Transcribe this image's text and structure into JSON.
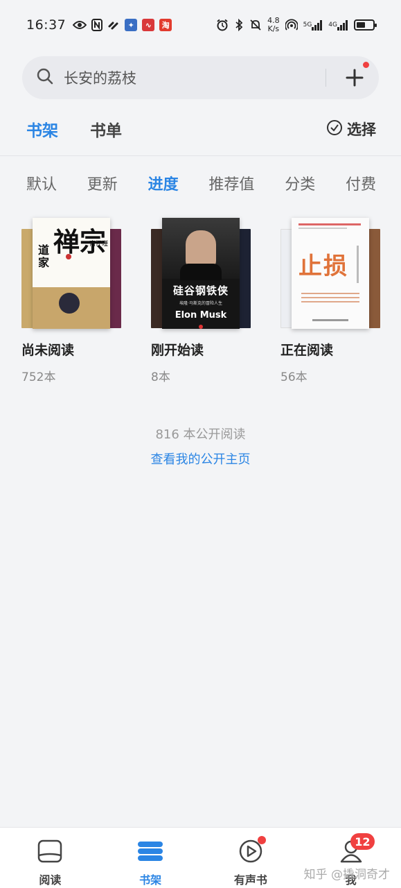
{
  "status_bar": {
    "time": "16:37",
    "net_speed_value": "4.8",
    "net_speed_unit": "K/s",
    "sim1_type": "5G",
    "sim2_type": "4G",
    "app_badges": [
      {
        "name": "flash-app-icon",
        "text": "∿",
        "color": "#d9383a"
      },
      {
        "name": "taobao-app-icon",
        "text": "淘",
        "color": "#e23b2e"
      }
    ]
  },
  "search": {
    "placeholder": "长安的荔枝"
  },
  "top_tabs": [
    {
      "label": "书架",
      "active": true
    },
    {
      "label": "书单",
      "active": false
    }
  ],
  "select_label": "选择",
  "sort_tabs": [
    {
      "label": "默认",
      "active": false
    },
    {
      "label": "更新",
      "active": false
    },
    {
      "label": "进度",
      "active": true
    },
    {
      "label": "推荐值",
      "active": false
    },
    {
      "label": "分类",
      "active": false
    },
    {
      "label": "付费",
      "active": false
    }
  ],
  "shelves": [
    {
      "name": "尚未阅读",
      "count": "752本",
      "cover_title": "禅宗",
      "cover_subtitle": "道家",
      "cover_author": "南怀瑾"
    },
    {
      "name": "刚开始读",
      "count": "8本",
      "cover_title": "硅谷钢铁侠",
      "cover_subtitle": "埃隆·马斯克的冒险人生",
      "cover_author": "Elon Musk"
    },
    {
      "name": "正在阅读",
      "count": "56本",
      "cover_title": "止损",
      "cover_subtitle": "",
      "cover_author": ""
    }
  ],
  "public_count": "816 本公开阅读",
  "public_link": "查看我的公开主页",
  "bottom_nav": [
    {
      "label": "阅读",
      "active": false
    },
    {
      "label": "书架",
      "active": true
    },
    {
      "label": "有声书",
      "active": false
    },
    {
      "label": "我",
      "active": false,
      "badge": "12"
    }
  ],
  "watermark": "知乎 @撬洞奇才",
  "colors": {
    "accent": "#2b85e4",
    "badge": "#f04040",
    "background": "#f3f4f6"
  }
}
